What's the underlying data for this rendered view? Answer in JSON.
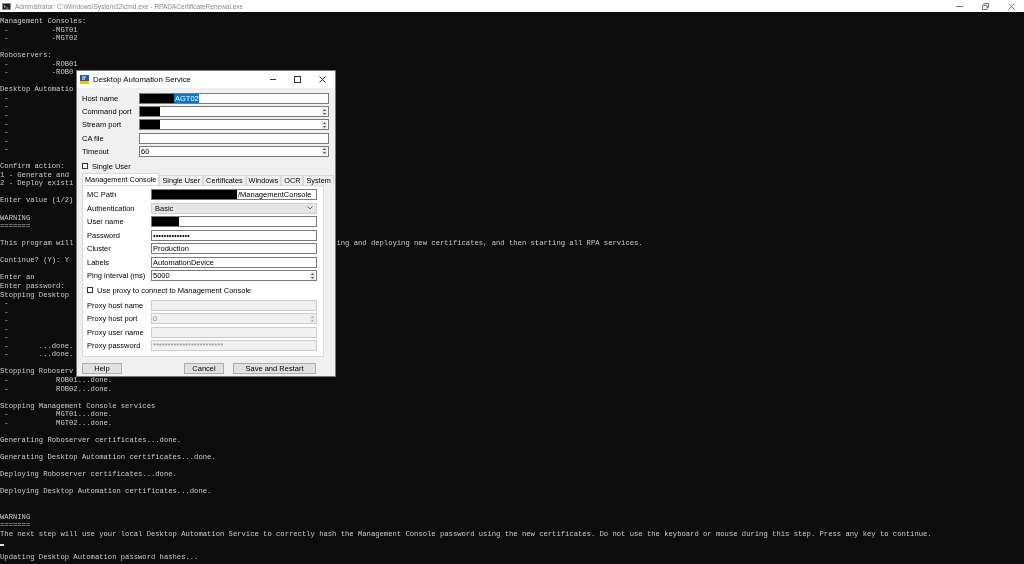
{
  "window": {
    "title": "Administrator: C:\\Windows\\System32\\cmd.exe - RPADACertificateRenewal.exe"
  },
  "console": {
    "lines": [
      {
        "text": "Management Consoles:"
      },
      {
        "text": " -          -MGT01"
      },
      {
        "text": " -          -MGT02"
      },
      {
        "kind": "blank"
      },
      {
        "text": "Roboservers:"
      },
      {
        "text": " -          -ROB01"
      },
      {
        "text": " -          -ROB0"
      },
      {
        "kind": "blank"
      },
      {
        "text": "Desktop Automatio"
      },
      {
        "text": " -"
      },
      {
        "text": " -"
      },
      {
        "text": " -"
      },
      {
        "text": " -"
      },
      {
        "text": " -"
      },
      {
        "text": " -"
      },
      {
        "text": " -"
      },
      {
        "kind": "blank"
      },
      {
        "text": "Confirm action:"
      },
      {
        "text": "1 - Generate and"
      },
      {
        "text": "2 - Deploy existi"
      },
      {
        "kind": "blank"
      },
      {
        "text": "Enter value (1/2)"
      },
      {
        "kind": "blank"
      },
      {
        "text": "WARNING"
      },
      {
        "text": "======="
      },
      {
        "kind": "blank"
      },
      {
        "text": "This program will",
        "right_text": "ing and deploying new certificates, and then starting all RPA services."
      },
      {
        "kind": "blank"
      },
      {
        "text": "Continue? (Y): Y"
      },
      {
        "kind": "blank"
      },
      {
        "text": "Enter an"
      },
      {
        "text": "Enter password:"
      },
      {
        "text": "Stopping Desktop"
      },
      {
        "text": " -"
      },
      {
        "text": " -"
      },
      {
        "text": " -"
      },
      {
        "text": " -"
      },
      {
        "text": " -"
      },
      {
        "text": " -       ...done."
      },
      {
        "text": " -       ...done."
      },
      {
        "kind": "blank"
      },
      {
        "text": "Stopping Roboserv"
      },
      {
        "text": " -           ROB01...done."
      },
      {
        "text": " -           ROB02...done."
      },
      {
        "kind": "blank"
      },
      {
        "text": "Stopping Management Console services"
      },
      {
        "text": " -           MGT01...done."
      },
      {
        "text": " -           MGT02...done."
      },
      {
        "kind": "blank"
      },
      {
        "text": "Generating Roboserver certificates...done."
      },
      {
        "kind": "blank"
      },
      {
        "text": "Generating Desktop Automation certificates...done."
      },
      {
        "kind": "blank"
      },
      {
        "text": "Deploying Roboserver certificates...done."
      },
      {
        "kind": "blank"
      },
      {
        "text": "Deploying Desktop Automation certificates...done."
      },
      {
        "kind": "blank"
      },
      {
        "kind": "blank"
      },
      {
        "text": "WARNING"
      },
      {
        "text": "======="
      },
      {
        "text": "The next step will use your local Desktop Automation Service to correctly hash the Management Console password using the new certificates. Do not use the keyboard or mouse during this step. Press any key to continue."
      },
      {
        "kind": "cursor"
      },
      {
        "text": "Updating Desktop Automation password hashes..."
      }
    ]
  },
  "dialog": {
    "title": "Desktop Automation Service",
    "fields": [
      {
        "label": "Host name",
        "kind": "text",
        "redacted": true,
        "value": "AGT02",
        "value_selected": true
      },
      {
        "label": "Command port",
        "kind": "spinner",
        "redacted": true
      },
      {
        "label": "Stream port",
        "kind": "spinner",
        "redacted": true
      },
      {
        "label": "CA file",
        "kind": "text"
      },
      {
        "label": "Timeout",
        "kind": "spinner",
        "value": "60"
      }
    ],
    "single_user": {
      "label": "Single User",
      "checked": false
    },
    "tabs": [
      {
        "label": "Management Console",
        "selected": true
      },
      {
        "label": "Single User",
        "selected": false
      },
      {
        "label": "Certificates",
        "selected": false
      },
      {
        "label": "Windows",
        "selected": false
      },
      {
        "label": "OCR",
        "selected": false
      },
      {
        "label": "System",
        "selected": false
      }
    ],
    "panel_fields": [
      {
        "label": "MC Path",
        "kind": "text",
        "redacted": true,
        "value": "/ManagementConsole"
      },
      {
        "label": "Authentication",
        "kind": "combo",
        "value": "Basic"
      },
      {
        "label": "User name",
        "kind": "text",
        "redacted": true
      },
      {
        "label": "Password",
        "kind": "text",
        "value": "••••••••••••••"
      },
      {
        "label": "Cluster",
        "kind": "text",
        "value": "Production"
      },
      {
        "label": "Labels",
        "kind": "text",
        "value": "AutomationDevice"
      },
      {
        "label": "Ping interval (ms)",
        "kind": "spinner",
        "value": "5000"
      }
    ],
    "proxy_checkbox": {
      "label": "Use proxy to connect to Management Console",
      "checked": false
    },
    "proxy_fields": [
      {
        "label": "Proxy host name",
        "kind": "text",
        "disabled": true
      },
      {
        "label": "Proxy host port",
        "kind": "spinner",
        "disabled": true,
        "value": "0"
      },
      {
        "label": "Proxy user name",
        "kind": "text",
        "disabled": true
      },
      {
        "label": "Proxy password",
        "kind": "text",
        "disabled": true,
        "value": "************************"
      }
    ],
    "buttons": [
      {
        "label": "Help"
      },
      {
        "label": "Cancel"
      },
      {
        "label": "Save and Restart"
      }
    ]
  }
}
